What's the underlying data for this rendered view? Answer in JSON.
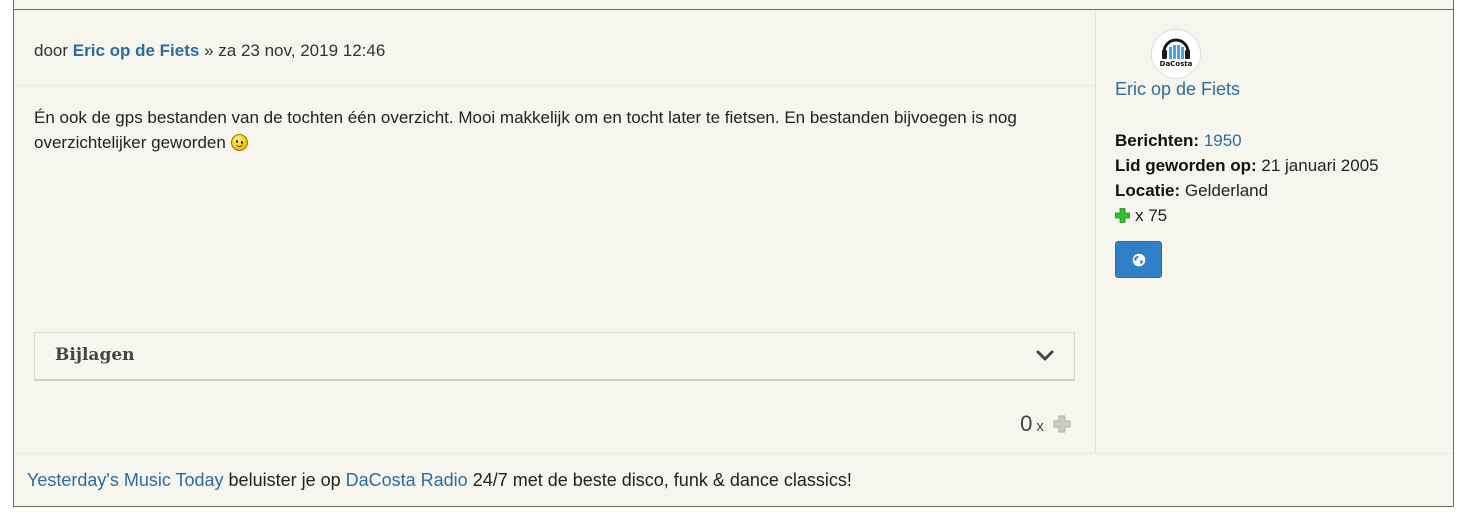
{
  "post": {
    "by_prefix": "door",
    "author": "Eric op de Fiets",
    "date_sep": "»",
    "date": "za 23 nov, 2019 12:46",
    "content_text": "Én ook de gps bestanden van de tochten één overzicht. Mooi makkelijk om en tocht later te fietsen. En bestanden bijvoegen is nog overzichtelijker geworden",
    "smiley_icon": "wink-smiley-icon",
    "attachments_label": "Bijlagen",
    "thanks_count": "0",
    "thanks_x": "x"
  },
  "profile": {
    "username": "Eric op de Fiets",
    "avatar_text": "DaCosta",
    "posts_label": "Berichten:",
    "posts_value": "1950",
    "joined_label": "Lid geworden op:",
    "joined_value": "21 januari 2005",
    "location_label": "Locatie:",
    "location_value": "Gelderland",
    "thanks_received": "x 75",
    "website_icon": "globe-icon"
  },
  "footer": {
    "link1": "Yesterday's Music Today",
    "text1": " beluister je op ",
    "link2": "DaCosta Radio",
    "text2": " 24/7 met de beste disco, funk & dance classics!"
  },
  "colors": {
    "link": "#2d6ca2",
    "background": "#f6f6ee",
    "button": "#2f80c6",
    "plus_green": "#2fbf2f"
  }
}
